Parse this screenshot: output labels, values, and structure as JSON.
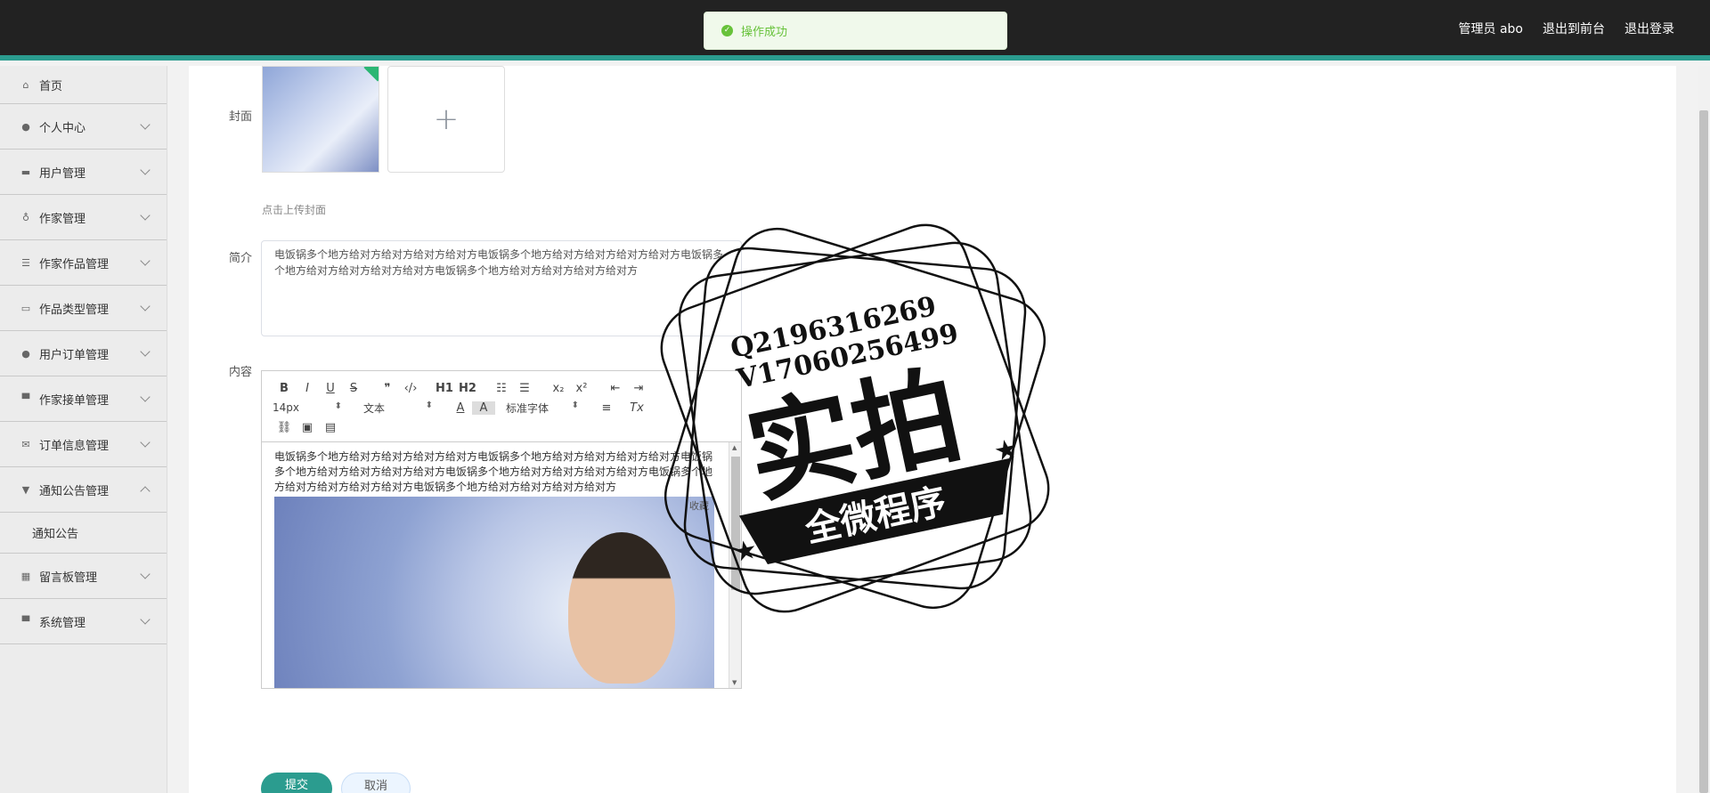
{
  "header": {
    "admin_label": "管理员 abo",
    "to_front": "退出到前台",
    "logout": "退出登录"
  },
  "toast": {
    "message": "操作成功"
  },
  "sidebar": {
    "items": [
      {
        "label": "首页",
        "icon": "home-icon"
      },
      {
        "label": "个人中心",
        "icon": "user-icon"
      },
      {
        "label": "用户管理",
        "icon": "ticket-icon"
      },
      {
        "label": "作家管理",
        "icon": "mic-icon"
      },
      {
        "label": "作家作品管理",
        "icon": "sliders-icon"
      },
      {
        "label": "作品类型管理",
        "icon": "card-icon"
      },
      {
        "label": "用户订单管理",
        "icon": "person-icon"
      },
      {
        "label": "作家接单管理",
        "icon": "monitor-icon"
      },
      {
        "label": "订单信息管理",
        "icon": "mail-icon"
      },
      {
        "label": "通知公告管理",
        "icon": "pin-icon"
      },
      {
        "label": "留言板管理",
        "icon": "grid-icon"
      },
      {
        "label": "系统管理",
        "icon": "desktop-icon"
      }
    ],
    "sub_item": "通知公告"
  },
  "form": {
    "cover_label": "封面",
    "upload_tip": "点击上传封面",
    "summary_label": "简介",
    "summary_value": "电饭锅多个地方给对方给对方给对方给对方电饭锅多个地方给对方给对方给对方给对方电饭锅多个地方给对方给对方给对方给对方电饭锅多个地方给对方给对方给对方给对方",
    "content_label": "内容",
    "content_text": "电饭锅多个地方给对方给对方给对方给对方电饭锅多个地方给对方给对方给对方给对方电饭锅多个地方给对方给对方给对方给对方电饭锅多个地方给对方给对方给对方给对方电饭锅多个地方给对方给对方给对方给对方电饭锅多个地方给对方给对方给对方给对方",
    "image_caption": "收藏",
    "submit": "提交",
    "cancel": "取消"
  },
  "toolbar": {
    "font_size": "14px",
    "text_type": "文本",
    "font_family": "标准字体",
    "h1": "H1",
    "h2": "H2"
  },
  "stamp": {
    "line1": "Q2196316269",
    "line2": "V17060256499",
    "big": "实拍",
    "ribbon": "全微程序"
  },
  "colors": {
    "accent": "#2b9c8f",
    "topbar": "#222222",
    "toast_bg": "#f0f9eb",
    "toast_text": "#67c23a"
  }
}
